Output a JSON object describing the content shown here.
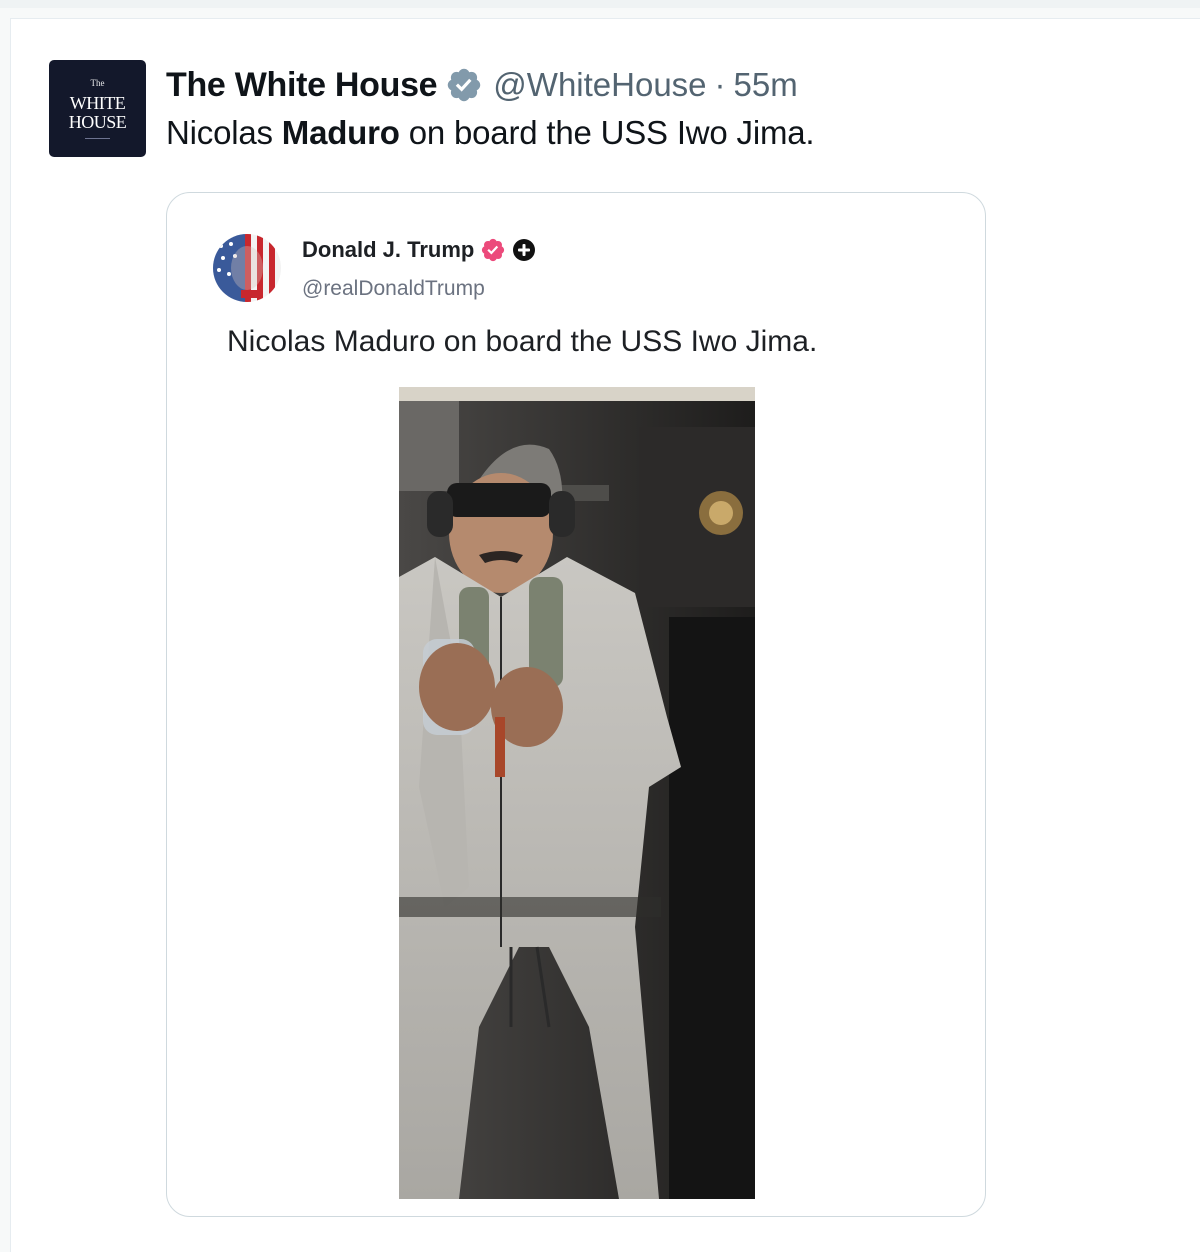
{
  "tweet": {
    "author_name": "The White House",
    "author_handle": "@WhiteHouse",
    "separator": "·",
    "time": "55m",
    "text_pre": "Nicolas ",
    "text_bold": "Maduro",
    "text_post": " on board the USS Iwo Jima.",
    "avatar": {
      "line0": "The",
      "line1": "WHITE",
      "line2": "HOUSE"
    },
    "verified_badge_color": "#829aab"
  },
  "quoted_post": {
    "author_name": "Donald J. Trump",
    "author_handle": "@realDonaldTrump",
    "text": "Nicolas Maduro on board the USS Iwo Jima.",
    "verified_badge_color": "#ec4a7b",
    "icons": [
      "verified-badge-icon",
      "plus-badge-icon"
    ],
    "image": {
      "kind": "photo",
      "subject": "man in gray tracksuit wearing blackout goggles and ear protection"
    }
  },
  "colors": {
    "secondary_text": "#536471",
    "border": "#cfd9de"
  }
}
